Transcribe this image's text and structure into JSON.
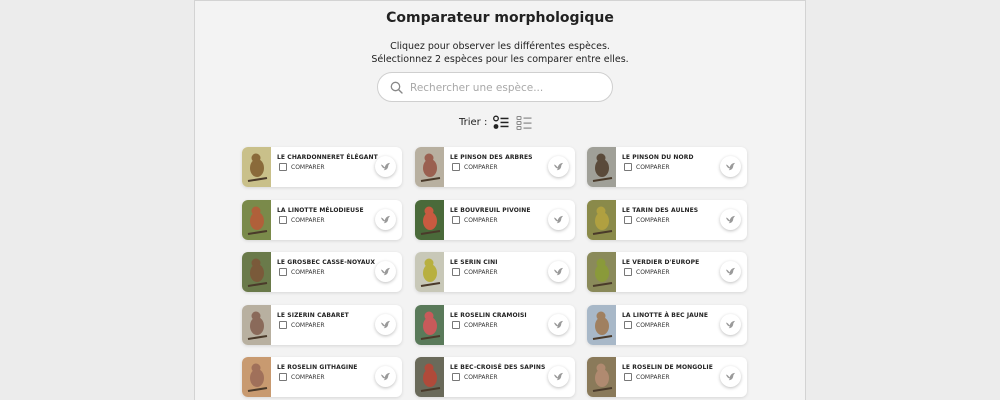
{
  "header": {
    "title": "Comparateur morphologique",
    "subtitle_line1": "Cliquez pour observer les différentes espèces.",
    "subtitle_line2": "Sélectionnez 2 espèces pour les comparer entre elles."
  },
  "search": {
    "placeholder": "Rechercher une espèce...",
    "value": ""
  },
  "sort": {
    "label": "Trier :",
    "options": [
      "list-detail-icon",
      "list-compact-icon"
    ],
    "active": 0
  },
  "compare_label": "COMPARER",
  "colors": {
    "accent": "#222222",
    "card_bg": "#ffffff",
    "panel_bg": "#f3f3f3"
  },
  "species": [
    {
      "name": "LE CHARDONNERET ÉLÉGANT",
      "bg": "#c9c08a",
      "bird": "#8a6a3a"
    },
    {
      "name": "LE PINSON DES ARBRES",
      "bg": "#b8b0a0",
      "bird": "#9a6050"
    },
    {
      "name": "LE PINSON DU NORD",
      "bg": "#a0a098",
      "bird": "#5a4a3a"
    },
    {
      "name": "LA LINOTTE MÉLODIEUSE",
      "bg": "#7a8a4a",
      "bird": "#b0603a"
    },
    {
      "name": "LE BOUVREUIL PIVOINE",
      "bg": "#4a6a3a",
      "bird": "#c85a40"
    },
    {
      "name": "LE TARIN DES AULNES",
      "bg": "#8a8a4a",
      "bird": "#b0a040"
    },
    {
      "name": "LE GROSBEC CASSE-NOYAUX",
      "bg": "#6a7a4a",
      "bird": "#7a5a3a"
    },
    {
      "name": "LE SERIN CINI",
      "bg": "#c8c8b8",
      "bird": "#b8b040"
    },
    {
      "name": "LE VERDIER D'EUROPE",
      "bg": "#8a8a5a",
      "bird": "#8a9a3a"
    },
    {
      "name": "LE SIZERIN CABARET",
      "bg": "#b8b0a0",
      "bird": "#8a6a5a"
    },
    {
      "name": "LE ROSELIN CRAMOISI",
      "bg": "#5a7a5a",
      "bird": "#c85a5a"
    },
    {
      "name": "LA LINOTTE À BEC JAUNE",
      "bg": "#a8b8c8",
      "bird": "#a08060"
    },
    {
      "name": "LE ROSELIN GITHAGINE",
      "bg": "#c89a70",
      "bird": "#a0705a"
    },
    {
      "name": "LE BEC-CROISÉ DES SAPINS",
      "bg": "#6a6a5a",
      "bird": "#b04a3a"
    },
    {
      "name": "LE ROSELIN DE MONGOLIE",
      "bg": "#8a7a5a",
      "bird": "#b08a70"
    }
  ]
}
